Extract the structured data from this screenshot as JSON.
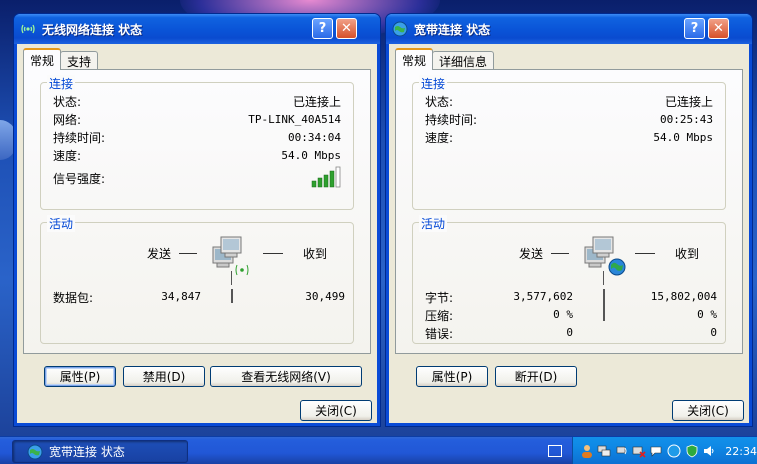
{
  "left_window": {
    "title": "无线网络连接 状态",
    "tabs": [
      "常规",
      "支持"
    ],
    "connection_group": "连接",
    "rows": [
      {
        "label": "状态:",
        "value": "已连接上"
      },
      {
        "label": "网络:",
        "value": "TP-LINK_40A514"
      },
      {
        "label": "持续时间:",
        "value": "00:34:04"
      },
      {
        "label": "速度:",
        "value": "54.0 Mbps"
      },
      {
        "label": "信号强度:",
        "value": ""
      }
    ],
    "signal_strength_bars": 5,
    "signal_strength_filled": 4,
    "activity_group": "活动",
    "sent_label": "发送",
    "received_label": "收到",
    "packets_label": "数据包:",
    "packets_sent": "34,847",
    "packets_received": "30,499",
    "buttons": {
      "properties": "属性(P)",
      "disable": "禁用(D)",
      "view_wireless": "查看无线网络(V)",
      "close": "关闭(C)"
    }
  },
  "right_window": {
    "title": "宽带连接 状态",
    "tabs": [
      "常规",
      "详细信息"
    ],
    "connection_group": "连接",
    "rows": [
      {
        "label": "状态:",
        "value": "已连接上"
      },
      {
        "label": "持续时间:",
        "value": "00:25:43"
      },
      {
        "label": "速度:",
        "value": "54.0 Mbps"
      }
    ],
    "activity_group": "活动",
    "sent_label": "发送",
    "received_label": "收到",
    "stats": [
      {
        "label": "字节:",
        "sent": "3,577,602",
        "received": "15,802,004"
      },
      {
        "label": "压缩:",
        "sent": "0 %",
        "received": "0 %"
      },
      {
        "label": "错误:",
        "sent": "0",
        "received": "0"
      }
    ],
    "buttons": {
      "properties": "属性(P)",
      "disconnect": "断开(D)",
      "close": "关闭(C)"
    }
  },
  "title_buttons": {
    "help": "?",
    "close": "✕"
  },
  "taskbar": {
    "task_label": "宽带连接 状态",
    "clock": "22:34"
  },
  "colors": {
    "titlebar": "#0a55d8",
    "group_title": "#0046d5",
    "active_tab_accent": "#e69a1a",
    "signal_green": "#2ea02e"
  }
}
